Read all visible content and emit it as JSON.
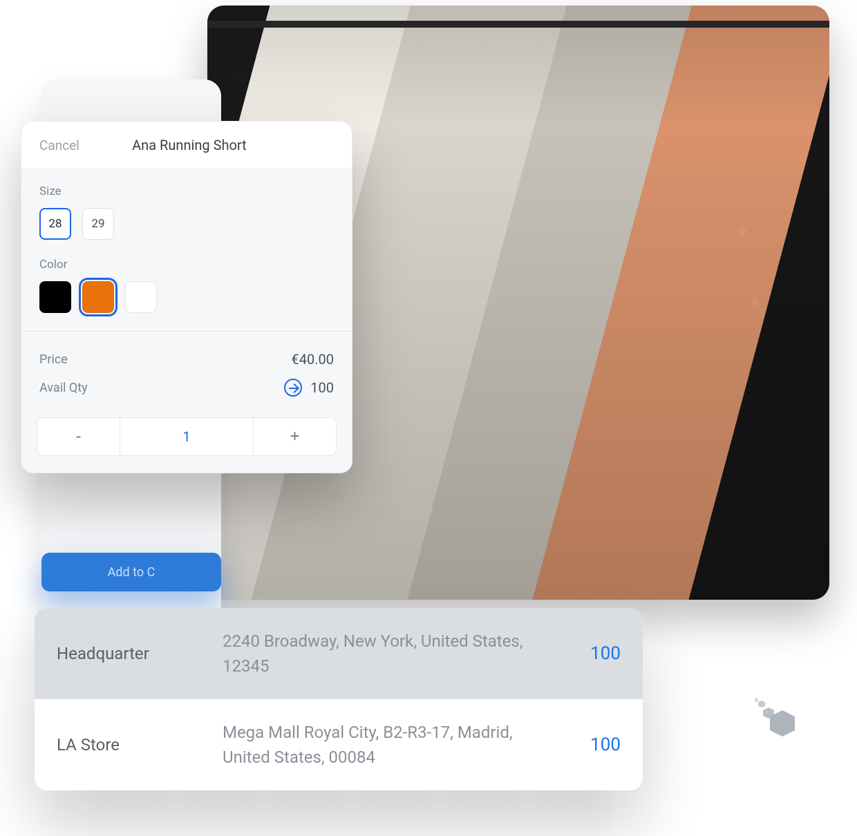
{
  "product_card": {
    "cancel_label": "Cancel",
    "title": "Ana Running Short",
    "size_label": "Size",
    "sizes": [
      "28",
      "29"
    ],
    "selected_size_index": 0,
    "color_label": "Color",
    "colors": [
      "#000000",
      "#e8730c",
      "#ffffff"
    ],
    "selected_color_index": 1,
    "price_label": "Price",
    "price_value": "€40.00",
    "avail_label": "Avail Qty",
    "avail_value": "100",
    "stepper": {
      "minus": "-",
      "value": "1",
      "plus": "+"
    }
  },
  "add_to_cart_peek": "Add to C",
  "locations": [
    {
      "name": "Headquarter",
      "address": "2240 Broadway, New York, United States, 12345",
      "qty": "100"
    },
    {
      "name": "LA Store",
      "address": "Mega Mall Royal City, B2-R3-17, Madrid, United States, 00084",
      "qty": "100"
    }
  ]
}
